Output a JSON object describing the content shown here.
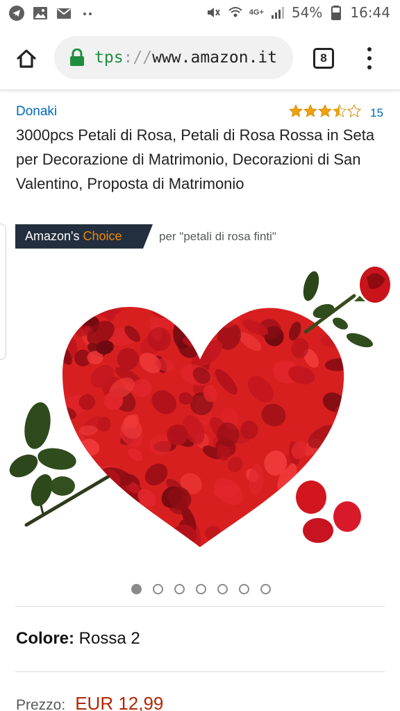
{
  "status_bar": {
    "left_icons": [
      "telegram-icon",
      "image-icon",
      "mail-icon",
      "more-dots-icon"
    ],
    "network": "4G+",
    "battery_percent": "54%",
    "time": "16:44"
  },
  "browser": {
    "url_scheme": "tps",
    "url_separator": "://",
    "url_host": "www.amazon.it",
    "tab_count": "8"
  },
  "product": {
    "brand": "Donaki",
    "rating_stars": 3.5,
    "review_count": "15",
    "title": "3000pcs Petali di Rosa, Petali di Rosa Rossa in Seta per Decorazione di Matrimonio, Decorazioni di San Valentino, Proposta di Matrimonio",
    "badge_prefix": "Amazon's",
    "badge_highlight": "Choice",
    "badge_query": "per \"petali di rosa finti\"",
    "image_count": 7,
    "active_image_index": 0,
    "color_label": "Colore:",
    "color_value": "Rossa 2",
    "price_label": "Prezzo:",
    "price_value": "EUR 12,99"
  },
  "colors": {
    "link": "#0066c0",
    "star": "#f0a10a",
    "badge_bg": "#232f3e",
    "badge_accent": "#f08804",
    "price": "#b12704",
    "secure": "#1e8e3e"
  }
}
